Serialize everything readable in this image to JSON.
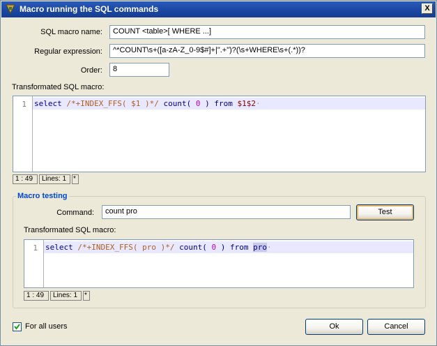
{
  "window": {
    "title": "Macro running the SQL commands",
    "close_label": "X"
  },
  "form": {
    "name_label": "SQL macro name:",
    "name_value": "COUNT <table>[ WHERE ...]",
    "regex_label": "Regular expression:",
    "regex_value": "^*COUNT\\s+([a-zA-Z_0-9$#]+|\".+\")?(\\s+WHERE\\s+(.*))?",
    "order_label": "Order:",
    "order_value": "8"
  },
  "transformed": {
    "label": "Transformated SQL macro:",
    "line_number": "1",
    "code": {
      "kw_select": "select",
      "comment": "/*+INDEX_FFS(",
      "var1": "$1",
      "comment_end": ")*/",
      "fn": "count(",
      "num": "0",
      "paren": ")",
      "kw_from": "from",
      "var2": "$1$2",
      "eol": "·"
    },
    "status_pos": "1 : 49",
    "status_lines": "Lines: 1",
    "status_mod": "*"
  },
  "testing": {
    "group_title": "Macro testing",
    "command_label": "Command:",
    "command_value": "count pro",
    "test_button": "Test",
    "result_label": "Transformated SQL macro:",
    "line_number": "1",
    "code": {
      "kw_select": "select",
      "comment": "/*+INDEX_FFS(",
      "ident": "pro",
      "comment_end": ")*/",
      "fn": "count(",
      "num": "0",
      "paren": ")",
      "kw_from": "from",
      "ident2": "pro",
      "eol": "·"
    },
    "status_pos": "1 : 49",
    "status_lines": "Lines: 1",
    "status_mod": "*"
  },
  "footer": {
    "for_all_users_label": "For all users",
    "for_all_users_checked": true,
    "ok_button": "Ok",
    "cancel_button": "Cancel"
  }
}
